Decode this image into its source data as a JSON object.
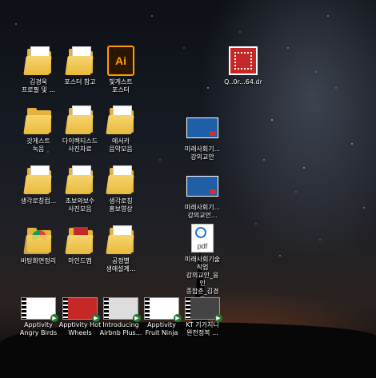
{
  "desktop": {
    "icons": [
      {
        "label": "김경욱\n프로필 및 ...",
        "type": "folder"
      },
      {
        "label": "포스터 참고",
        "type": "folder"
      },
      {
        "label": "빛게스트\n포스터",
        "type": "ai"
      },
      {
        "label": "Q..0r...64.dr",
        "type": "app-red"
      },
      {
        "label": "갓게스트\n녹음",
        "type": "folder"
      },
      {
        "label": "다이렉티스드\n사진자료",
        "type": "folder"
      },
      {
        "label": "에서카\n음악모음",
        "type": "folder"
      },
      {
        "label": "미래사회기...\n강의교안",
        "type": "slide"
      },
      {
        "label": "생각로칭컴...",
        "type": "folder"
      },
      {
        "label": "조보와보수\n사진모음",
        "type": "folder"
      },
      {
        "label": "생각로칭\n홍보영상",
        "type": "folder"
      },
      {
        "label": "미래사회기...\n강의교안...",
        "type": "slide"
      },
      {
        "label": "바탕화면정리",
        "type": "chrome-folder"
      },
      {
        "label": "마인드맵",
        "type": "folder"
      },
      {
        "label": "공정별\n생애설계...",
        "type": "folder"
      },
      {
        "label": "미래사회기술\n직업\n강의교안_응\n인\n종합춘_김경\n욱",
        "type": "pdf"
      },
      {
        "label": "Apptivity\nAngry Birds",
        "type": "video"
      },
      {
        "label": "Apptivity Hot\nWheels",
        "type": "video"
      },
      {
        "label": "Introducing\nAirbnb Plus...",
        "type": "video"
      },
      {
        "label": "Apptivity\nFruit Ninja",
        "type": "video"
      },
      {
        "label": "KT 기가지니\n완전정복 ...",
        "type": "video"
      }
    ],
    "ai_text": "Ai",
    "pdf_text": "pdf",
    "colors": {
      "folder": "#e5b33c",
      "ai_bg": "#2b1700",
      "ai_fg": "#ff9a00",
      "slide": "#1f5fa8",
      "pdf_red": "#d32f2f"
    }
  }
}
